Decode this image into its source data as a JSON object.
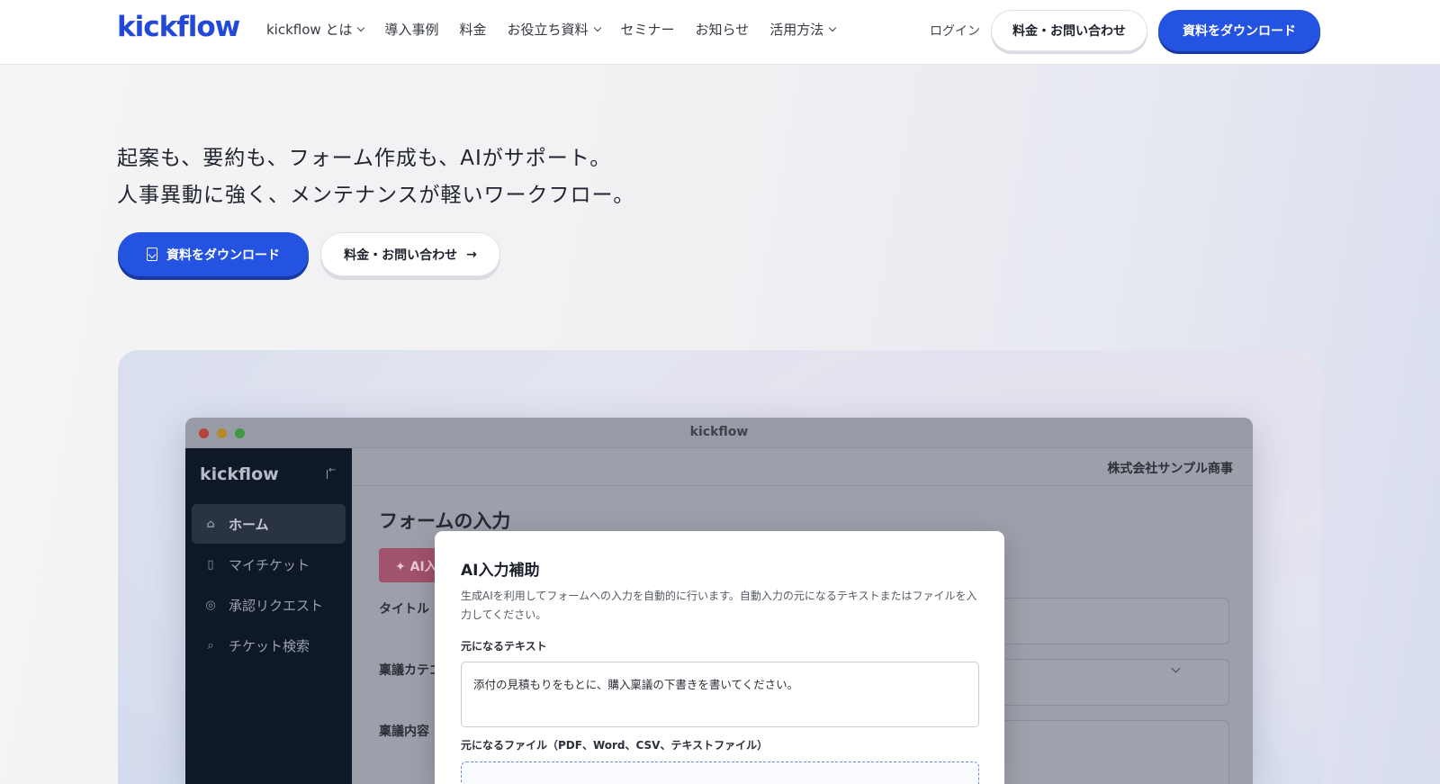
{
  "header": {
    "logo": "kickflow",
    "nav": [
      {
        "label": "kickflow とは",
        "dropdown": true
      },
      {
        "label": "導入事例",
        "dropdown": false
      },
      {
        "label": "料金",
        "dropdown": false
      },
      {
        "label": "お役立ち資料",
        "dropdown": true
      },
      {
        "label": "セミナー",
        "dropdown": false
      },
      {
        "label": "お知らせ",
        "dropdown": false
      },
      {
        "label": "活用方法",
        "dropdown": true
      }
    ],
    "login": "ログイン",
    "contact_button": "料金・お問い合わせ",
    "download_button": "資料をダウンロード"
  },
  "hero": {
    "line1": "起案も、要約も、フォーム作成も、AIがサポート。",
    "line2": "人事異動に強く、メンテナンスが軽いワークフロー。",
    "cta_download": "資料をダウンロード",
    "cta_contact": "料金・お問い合わせ",
    "cta_contact_arrow": "→"
  },
  "app_window": {
    "title": "kickflow",
    "sidebar": {
      "logo": "kickflow",
      "items": [
        {
          "label": "ホーム",
          "icon": "home-icon",
          "glyph": "⌂",
          "active": true
        },
        {
          "label": "マイチケット",
          "icon": "ticket-icon",
          "glyph": "▯",
          "active": false
        },
        {
          "label": "承認リクエスト",
          "icon": "check-circle-icon",
          "glyph": "◎",
          "active": false
        },
        {
          "label": "チケット検索",
          "icon": "search-icon",
          "glyph": "⌕",
          "active": false
        }
      ]
    },
    "company": "株式会社サンプル商事",
    "form_title": "フォームの入力",
    "ai_button": "✦ AI入力補助",
    "fields": [
      "タイトル",
      "稟議カテゴリ",
      "稟議内容"
    ]
  },
  "modal": {
    "title": "AI入力補助",
    "description": "生成AIを利用してフォームへの入力を自動的に行います。自動入力の元になるテキストまたはファイルを入力してください。",
    "text_label": "元になるテキスト",
    "text_value": "添付の見積もりをもとに、購入稟議の下書きを書いてください。",
    "file_label": "元になるファイル（PDF、Word、CSV、テキストファイル）"
  },
  "colors": {
    "brand_blue": "#2353e0",
    "sidebar_dark": "#0f1826",
    "ai_pink": "#a1526c"
  }
}
